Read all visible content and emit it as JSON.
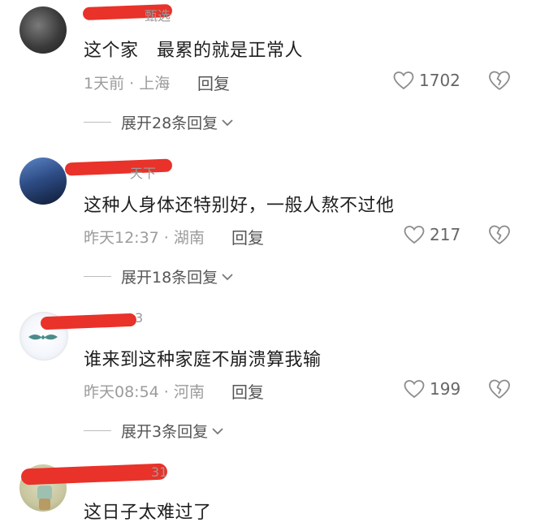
{
  "comments": [
    {
      "username_tail": "甄选",
      "text": "这个家   最累的就是正常人",
      "time": "1天前 · 上海",
      "reply_label": "回复",
      "likes": "1702",
      "expand_label": "展开28条回复"
    },
    {
      "username_tail": "天下",
      "text": "这种人身体还特别好，一般人熬不过他",
      "time": "昨天12:37 · 湖南",
      "reply_label": "回复",
      "likes": "217",
      "expand_label": "展开18条回复"
    },
    {
      "username_tail": "3",
      "text": "谁来到这种家庭不崩溃算我输",
      "time": "昨天08:54 · 河南",
      "reply_label": "回复",
      "likes": "199",
      "expand_label": "展开3条回复"
    },
    {
      "username_tail": "31",
      "text": "这日子太难过了"
    }
  ]
}
